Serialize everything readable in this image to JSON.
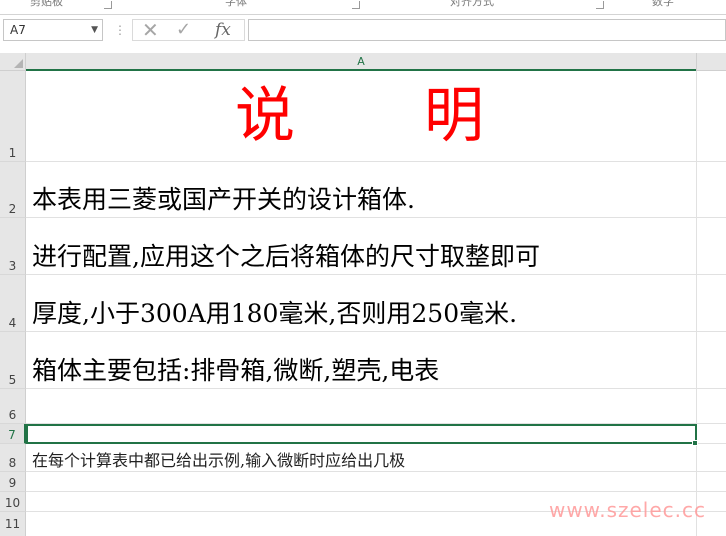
{
  "ribbon": {
    "groups": [
      "剪贴板",
      "字体",
      "对齐方式",
      "数字"
    ]
  },
  "formula_bar": {
    "name_box": "A7",
    "fx": "fx",
    "formula_value": ""
  },
  "sheet": {
    "column": "A",
    "row_numbers": [
      "1",
      "2",
      "3",
      "4",
      "5",
      "6",
      "7",
      "8",
      "9",
      "10",
      "11"
    ],
    "cells": {
      "A1": "说　　明",
      "A2": "本表用三菱或国产开关的设计箱体.",
      "A3": "进行配置,应用这个之后将箱体的尺寸取整即可",
      "A4": "厚度,小于300A用180毫米,否则用250毫米.",
      "A5": "箱体主要包括:排骨箱,微断,塑壳,电表",
      "A6": "",
      "A7": "",
      "A8": "在每个计算表中都已给出示例,输入微断时应给出几极"
    }
  },
  "watermark": "www.szelec.cc",
  "colors": {
    "accent": "#217346",
    "title": "#ff0000"
  }
}
